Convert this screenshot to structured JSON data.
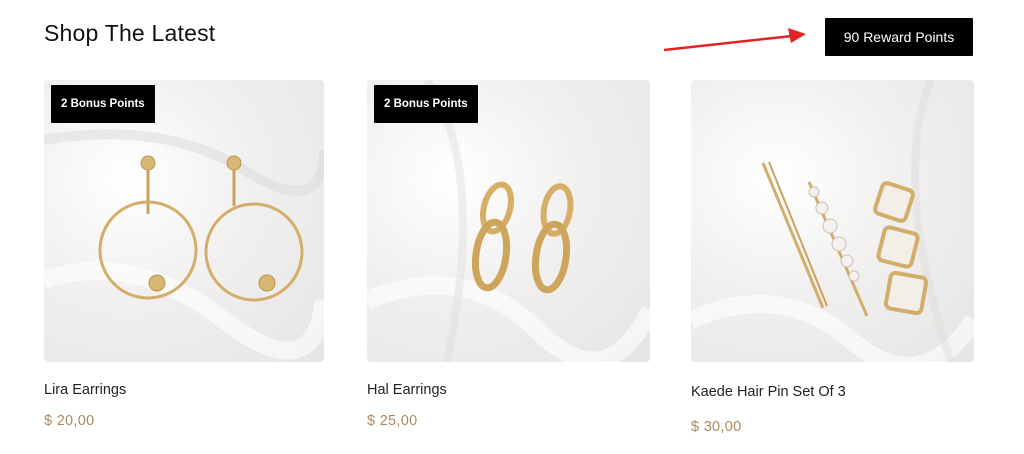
{
  "section": {
    "title": "Shop The Latest"
  },
  "reward": {
    "label": "90 Reward Points"
  },
  "colors": {
    "accent_price": "#a88a5f",
    "badge_bg": "#000000",
    "arrow": "#e02424"
  },
  "products": [
    {
      "name": "Lira Earrings",
      "price": "$ 20,00",
      "bonus": "2 Bonus Points",
      "image_icon": "hoop-earrings-icon"
    },
    {
      "name": "Hal Earrings",
      "price": "$ 25,00",
      "bonus": "2 Bonus Points",
      "image_icon": "chain-link-earrings-icon"
    },
    {
      "name": "Kaede Hair Pin Set Of 3",
      "price": "$ 30,00",
      "bonus": "",
      "image_icon": "hair-pin-set-icon"
    }
  ]
}
